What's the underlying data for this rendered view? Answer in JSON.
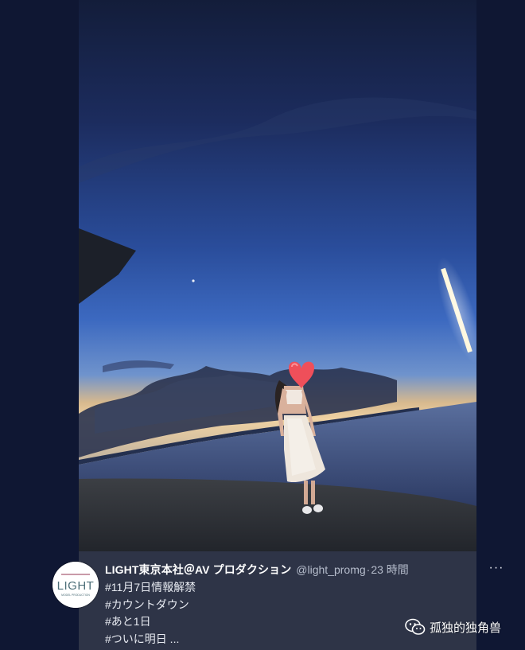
{
  "photo": {
    "alt": "",
    "colors": {
      "sky_top": "#16213f",
      "sky_mid": "#2d5bb5",
      "sky_horizon": "#e9c79a",
      "sea": "#3b4a73",
      "ground": "#34383f",
      "heart": "#ef4f5a"
    }
  },
  "tweet": {
    "display_name": "LIGHT東京本社＠AV プロダクション",
    "handle": "@light_promg",
    "separator": "·",
    "time": "23 時間",
    "more_label": "···",
    "lines": [
      "#11月7日情報解禁",
      "#カウントダウン",
      "#あと1日",
      "#ついに明日 ..."
    ]
  },
  "avatar": {
    "brand_top": "",
    "brand_main": "LIGHT",
    "brand_sub": "MODEL PRODUCTION"
  },
  "watermark": {
    "icon": "wechat-icon",
    "text": "孤独的独角兽"
  }
}
